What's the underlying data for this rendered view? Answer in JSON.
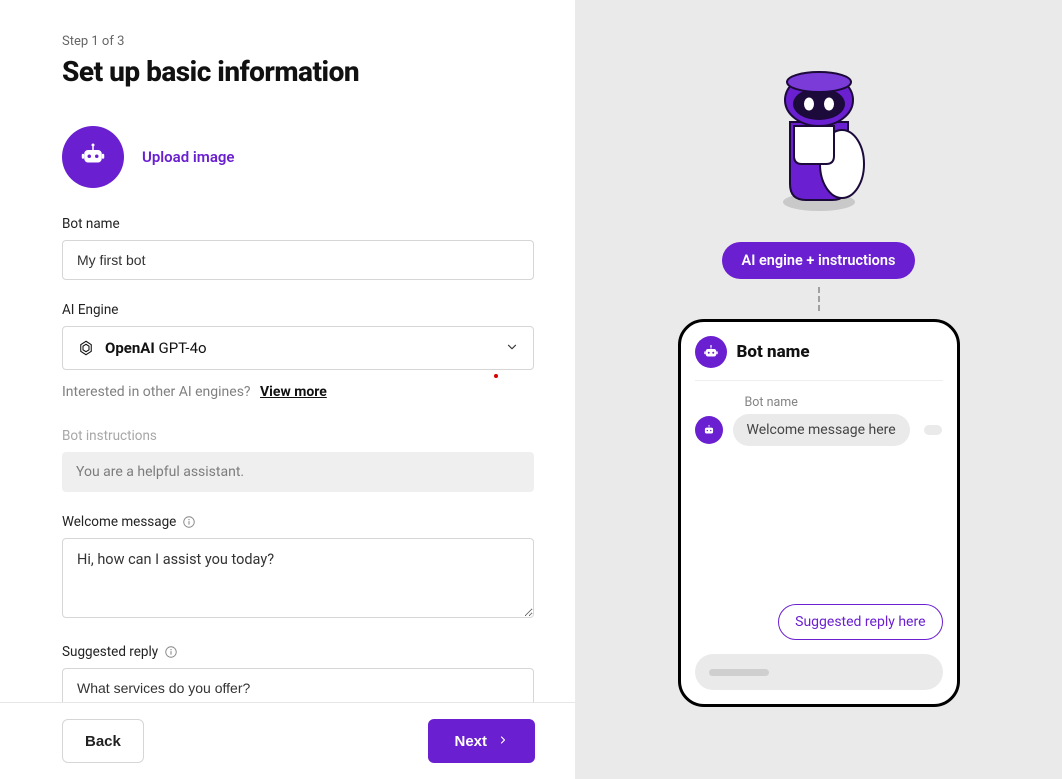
{
  "step_indicator": "Step 1 of 3",
  "page_title": "Set up basic information",
  "upload": {
    "link_label": "Upload image"
  },
  "fields": {
    "bot_name": {
      "label": "Bot name",
      "value": "My first bot"
    },
    "ai_engine": {
      "label": "AI Engine",
      "brand": "OpenAI",
      "model": "GPT-4o",
      "note_prefix": "Interested in other AI engines?",
      "view_more": "View more"
    },
    "bot_instructions": {
      "label": "Bot instructions",
      "value": "You are a helpful assistant."
    },
    "welcome_message": {
      "label": "Welcome message",
      "value": "Hi, how can I assist you today?"
    },
    "suggested_reply": {
      "label": "Suggested reply",
      "value": "What services do you offer?"
    }
  },
  "buttons": {
    "back": "Back",
    "next": "Next"
  },
  "preview": {
    "pill_label": "AI engine + instructions",
    "header_title": "Bot name",
    "sender_label": "Bot name",
    "welcome_bubble": "Welcome message here",
    "suggested_bubble": "Suggested reply here"
  },
  "colors": {
    "accent": "#6a1fd0"
  }
}
